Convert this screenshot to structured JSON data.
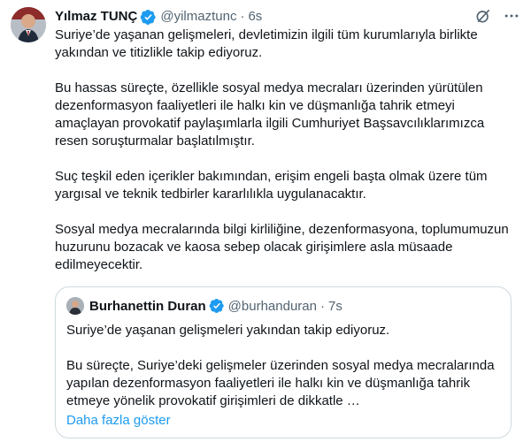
{
  "tweet": {
    "author_name": "Yılmaz TUNÇ",
    "handle": "@yilmaztunc",
    "separator": "·",
    "time": "6s",
    "paragraphs": [
      "Suriye’de yaşanan gelişmeleri, devletimizin ilgili tüm kurumlarıyla birlikte yakından ve titizlikle takip ediyoruz.",
      "Bu hassas süreçte, özellikle sosyal medya mecraları üzerinden yürütülen dezenformasyon faaliyetleri ile halkı kin ve düşmanlığa tahrik etmeyi amaçlayan provokatif paylaşımlarla ilgili Cumhuriyet Başsavcılıklarımızca resen soruşturmalar başlatılmıştır.",
      "Suç teşkil eden içerikler bakımından, erişim engeli başta olmak üzere tüm yargısal ve teknik tedbirler kararlılıkla uygulanacaktır.",
      "Sosyal medya mecralarında bilgi kirliliğine, dezenformasyona, toplumumuzun huzurunu bozacak ve kaosa sebep olacak girişimlere asla müsaade edilmeyecektir."
    ]
  },
  "quote": {
    "author_name": "Burhanettin Duran",
    "handle": "@burhanduran",
    "separator": "·",
    "time": "7s",
    "paragraphs": [
      "Suriye’de yaşanan gelişmeleri yakından takip ediyoruz.",
      "Bu süreçte, Suriye’deki gelişmeler üzerinden sosyal medya mecralarında yapılan dezenformasyon faaliyetleri ile halkı kin ve düşmanlığa tahrik etmeye yönelik provokatif girişimleri de dikkatle …"
    ],
    "show_more": "Daha fazla göster"
  },
  "icons": {
    "verified": "verified-badge-icon",
    "grok": "grok-icon",
    "more": "more-icon"
  },
  "colors": {
    "text": "#0f1419",
    "secondary": "#536471",
    "link": "#1d9bf0",
    "verified": "#1d9bf0",
    "border": "#cfd9de"
  }
}
